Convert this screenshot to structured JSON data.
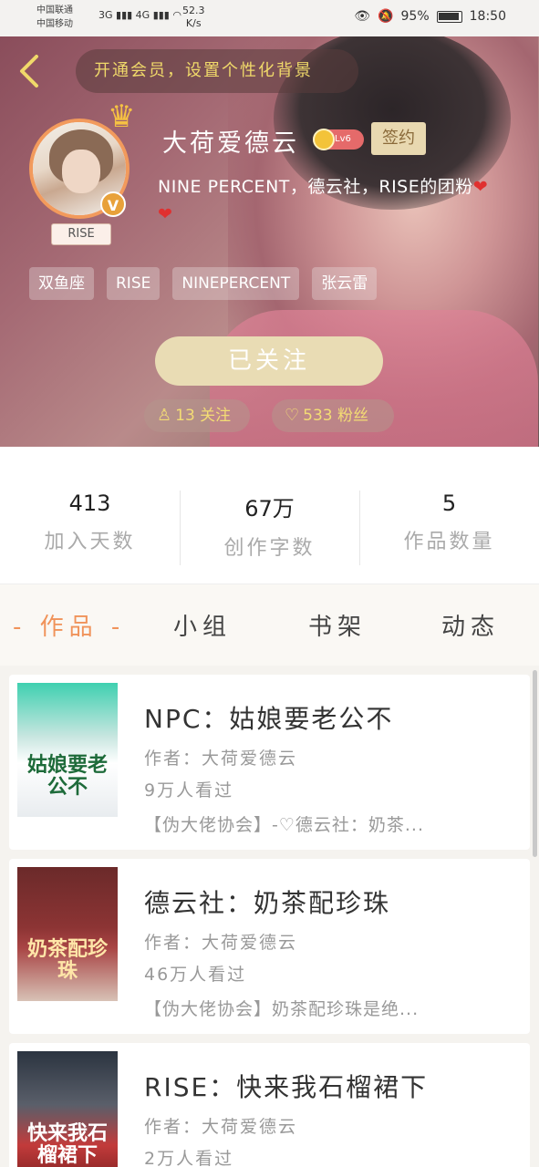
{
  "status_bar": {
    "carrier1": "中国联通",
    "carrier2": "中国移动",
    "signals": "3G ▮▮▮ 4G ▮▮▮ ◠",
    "speed_value": "52.3",
    "speed_unit": "K/s",
    "battery": "95%",
    "time": "18:50"
  },
  "header": {
    "vip_banner": "开通会员，设置个性化背景"
  },
  "profile": {
    "username": "大荷爱德云",
    "level": "Lv6",
    "signin_label": "签约",
    "avatar_tag": "RISE",
    "bio": "NINE PERCENT，德云社，RISE的团粉",
    "tags": [
      "双鱼座",
      "RISE",
      "NINEPERCENT",
      "张云雷"
    ],
    "follow_button": "已关注",
    "following_count": "13 关注",
    "fans_count": "533 粉丝"
  },
  "stats": [
    {
      "value": "413",
      "label": "加入天数"
    },
    {
      "value": "67万",
      "label": "创作字数"
    },
    {
      "value": "5",
      "label": "作品数量"
    }
  ],
  "tabs": [
    "- 作品 -",
    "小组",
    "书架",
    "动态"
  ],
  "works": [
    {
      "title": "NPC：姑娘要老公不",
      "author": "作者：大荷爱德云",
      "views": "9万人看过",
      "desc": "【伪大佬协会】-♡德云社：奶茶...",
      "cover_text": "姑娘要老公不"
    },
    {
      "title": "德云社：奶茶配珍珠",
      "author": "作者：大荷爱德云",
      "views": "46万人看过",
      "desc": "【伪大佬协会】奶茶配珍珠是绝...",
      "cover_text": "奶茶配珍珠"
    },
    {
      "title": "RISE：快来我石榴裙下",
      "author": "作者：大荷爱德云",
      "views": "2万人看过",
      "desc": "",
      "cover_text": "快来我石榴裙下"
    }
  ]
}
